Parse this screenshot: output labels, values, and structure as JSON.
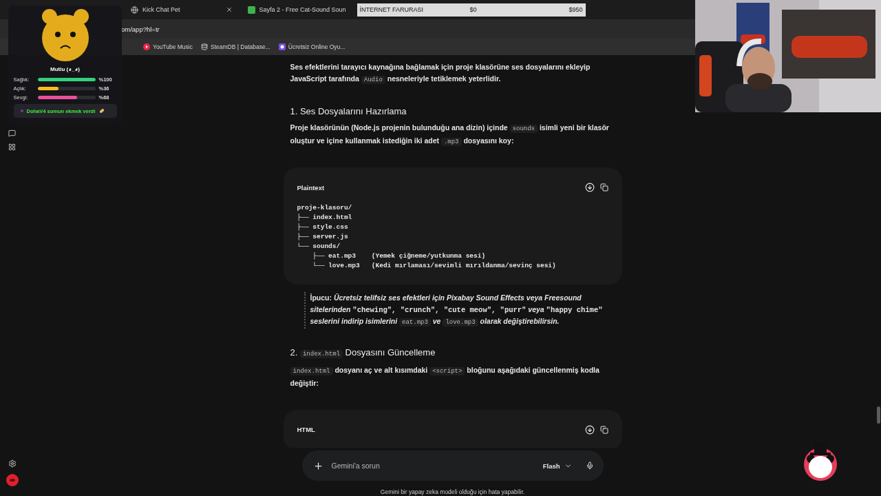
{
  "browser": {
    "tabs": [
      {
        "title": "Kick Chat Pet",
        "selected": false
      },
      {
        "title": "Sayfa 2 - Free Cat-Sound Soun",
        "selected": false
      }
    ],
    "address": "om/app?hl=tr",
    "bookmarks": [
      {
        "title": "YouTube Music"
      },
      {
        "title": "SteamDB | Database..."
      },
      {
        "title": "Ücretsiz Online Oyu..."
      }
    ]
  },
  "cost_bar": {
    "label": "İNTERNET FARURASI",
    "start": "$0",
    "end": "$950"
  },
  "pet_widget": {
    "mood": "Mutlu (◕_◕)",
    "stats": [
      {
        "label": "Sağlık:",
        "level": 1,
        "value": "%100",
        "color": "#35d07a"
      },
      {
        "label": "Açlık:",
        "level": 0.36,
        "value": "%36",
        "color": "#f5c01e"
      },
      {
        "label": "Sevgi:",
        "level": 0.68,
        "value": "%68",
        "color": "#ec4f9a"
      }
    ],
    "event": "DohaV4 somun ekmek verdi"
  },
  "article": {
    "blocks": [
      {
        "kind": "paragraph",
        "segments": [
          {
            "kind": "text",
            "text": "Ses efektlerini tarayıcı kaynağına bağlamak için proje klasörüne ses dosyalarını ekleyip JavaScript tarafında "
          },
          {
            "kind": "code",
            "text": "Audio"
          },
          {
            "kind": "text",
            "text": " nesneleriyle tetiklemek yeterlidir."
          }
        ]
      },
      {
        "kind": "heading",
        "segments": [
          {
            "kind": "text",
            "text": "1. Ses Dosyalarını Hazırlama"
          }
        ]
      },
      {
        "kind": "paragraph",
        "segments": [
          {
            "kind": "text",
            "text": "Proje klasörünün (Node.js projenin bulunduğu ana dizin) içinde "
          },
          {
            "kind": "code",
            "text": "sounds"
          },
          {
            "kind": "text",
            "text": " isimli yeni bir klasör oluştur ve içine kullanmak istediğin iki adet "
          },
          {
            "kind": "code",
            "text": ".mp3"
          },
          {
            "kind": "text",
            "text": " dosyasını koy:"
          }
        ]
      },
      {
        "kind": "code",
        "language": "Plaintext",
        "lines": [
          "proje-klasoru/",
          "├── index.html",
          "├── style.css",
          "├── server.js",
          "└── sounds/",
          "    ├── eat.mp3    (Yemek çiğneme/yutkunma sesi)",
          "    └── love.mp3   (Kedi mırlaması/sevimli mırıldanma/sevinç sesi)"
        ]
      },
      {
        "kind": "tip",
        "segments": [
          {
            "kind": "bold",
            "text": "İpucu:"
          },
          {
            "kind": "italic",
            "text": " Ücretsiz telifsiz ses efektleri için Pixabay Sound Effects veya Freesound sitelerinden "
          },
          {
            "kind": "mono",
            "text": "\"chewing\", \"crunch\", \"cute meow\", \"purr\""
          },
          {
            "kind": "italic",
            "text": " veya "
          },
          {
            "kind": "mono",
            "text": "\"happy chime\""
          },
          {
            "kind": "italic",
            "text": " seslerini indirip isimlerini "
          },
          {
            "kind": "code",
            "text": "eat.mp3"
          },
          {
            "kind": "italic",
            "text": " ve "
          },
          {
            "kind": "code",
            "text": "love.mp3"
          },
          {
            "kind": "italic",
            "text": " olarak değiştirebilirsin."
          }
        ]
      },
      {
        "kind": "heading",
        "segments": [
          {
            "kind": "text",
            "text": "2. "
          },
          {
            "kind": "code",
            "text": "index.html"
          },
          {
            "kind": "text",
            "text": " Dosyasını Güncelleme"
          }
        ]
      },
      {
        "kind": "paragraph",
        "segments": [
          {
            "kind": "code",
            "text": "index.html"
          },
          {
            "kind": "text",
            "text": " dosyanı aç ve alt kısımdaki "
          },
          {
            "kind": "code",
            "text": "<script>"
          },
          {
            "kind": "text",
            "text": " bloğunu aşağıdaki güncellenmiş kodla değiştir:"
          }
        ]
      },
      {
        "kind": "code",
        "language": "HTML"
      }
    ]
  },
  "composer": {
    "placeholder": "Gemini'a sorun",
    "model": "Flash"
  },
  "disclaimer": "Gemini bir yapay zeka modeli olduğu için hata yapabilir."
}
